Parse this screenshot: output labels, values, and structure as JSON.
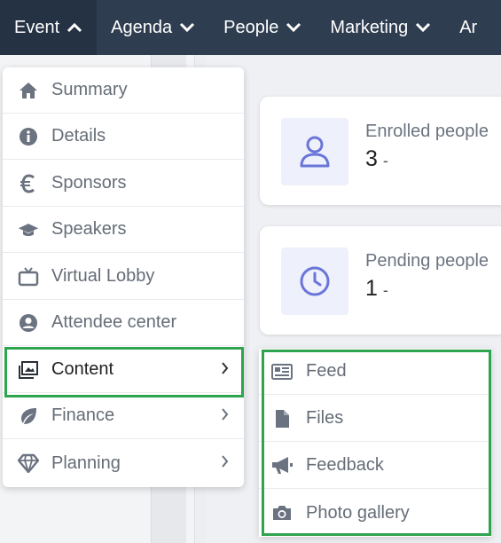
{
  "nav": {
    "items": [
      {
        "label": "Event",
        "chevron": "up"
      },
      {
        "label": "Agenda",
        "chevron": "down"
      },
      {
        "label": "People",
        "chevron": "down"
      },
      {
        "label": "Marketing",
        "chevron": "down"
      },
      {
        "label": "Ar",
        "chevron": "none"
      }
    ]
  },
  "stats": [
    {
      "label": "Enrolled people",
      "value": "3",
      "suffix": "-",
      "icon": "user-icon"
    },
    {
      "label": "Pending people",
      "value": "1",
      "suffix": "-",
      "icon": "clock-icon"
    }
  ],
  "menu": {
    "items": [
      {
        "label": "Summary",
        "icon": "home-icon"
      },
      {
        "label": "Details",
        "icon": "info-icon"
      },
      {
        "label": "Sponsors",
        "icon": "euro-icon"
      },
      {
        "label": "Speakers",
        "icon": "graduation-cap-icon"
      },
      {
        "label": "Virtual Lobby",
        "icon": "tv-icon"
      },
      {
        "label": "Attendee center",
        "icon": "user-circle-icon"
      },
      {
        "label": "Content",
        "icon": "images-icon",
        "has_submenu": true,
        "highlighted": true
      },
      {
        "label": "Finance",
        "icon": "leaf-icon",
        "has_submenu": true
      },
      {
        "label": "Planning",
        "icon": "gem-icon",
        "has_submenu": true
      }
    ]
  },
  "submenu": {
    "items": [
      {
        "label": "Feed",
        "icon": "newspaper-icon"
      },
      {
        "label": "Files",
        "icon": "file-icon"
      },
      {
        "label": "Feedback",
        "icon": "megaphone-icon"
      },
      {
        "label": "Photo gallery",
        "icon": "camera-icon"
      }
    ]
  },
  "colors": {
    "nav_bg": "#2e3d50",
    "highlight_border": "#2ea44f",
    "stat_icon": "#6a75d8",
    "menu_icon": "#6b7280"
  }
}
